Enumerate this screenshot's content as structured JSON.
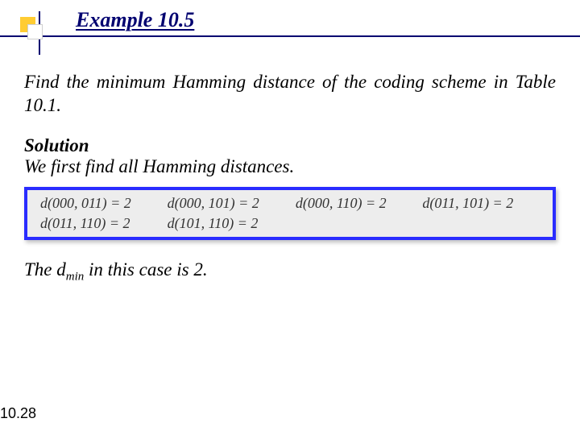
{
  "header": {
    "title": "Example 10.5"
  },
  "content": {
    "problem": "Find the minimum Hamming distance of the coding scheme in Table 10.1.",
    "solution_heading": "Solution",
    "solution_line": "We first find all Hamming distances.",
    "distances": {
      "row1": {
        "c1": "d(000, 011) = 2",
        "c2": "d(000, 101) = 2",
        "c3": "d(000, 110) = 2",
        "c4": "d(011, 101) = 2"
      },
      "row2": {
        "c1": "d(011, 110) = 2",
        "c2": "d(101, 110) = 2",
        "c3": "",
        "c4": ""
      }
    },
    "conclusion_pre": "The d",
    "conclusion_sub": "min",
    "conclusion_post": " in this case is 2."
  },
  "footer": {
    "page": "10.28"
  }
}
